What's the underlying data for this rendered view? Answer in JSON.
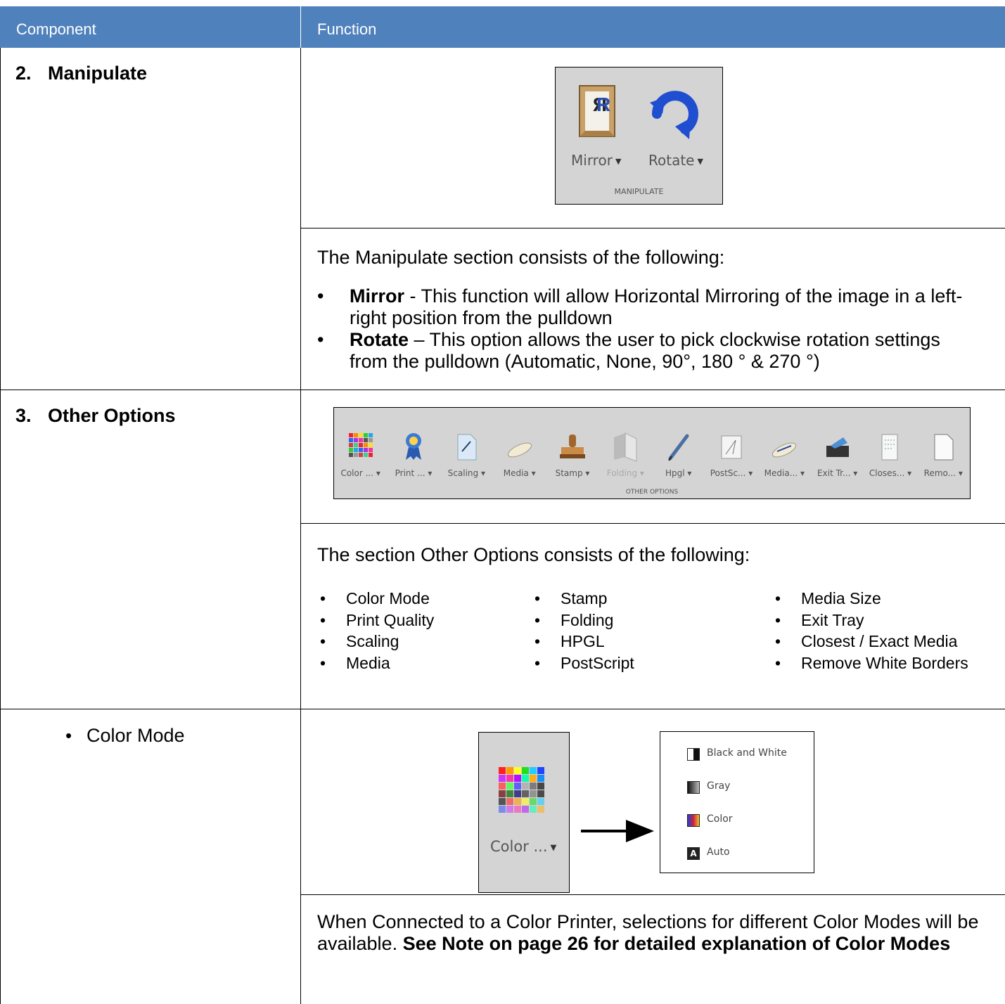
{
  "header": {
    "col1": "Component",
    "col2": "Function"
  },
  "manipulate": {
    "number": "2.",
    "label": "Manipulate",
    "toolbar": {
      "mirror": "Mirror",
      "rotate": "Rotate",
      "group": "MANIPULATE"
    },
    "intro": "The Manipulate section consists of the following:",
    "bullets": [
      {
        "bold": "Mirror",
        "text": " - This function will allow Horizontal Mirroring of the image in a left-right position from the pulldown"
      },
      {
        "bold": "Rotate",
        "text": " – This option allows the user to pick clockwise rotation settings from the pulldown (Automatic, None, 90°, 180 ° & 270 °)"
      }
    ]
  },
  "other": {
    "number": "3.",
    "label": "Other Options",
    "toolbar": {
      "items": [
        "Color ...",
        "Print ...",
        "Scaling",
        "Media",
        "Stamp",
        "Folding",
        "Hpgl",
        "PostSc...",
        "Media...",
        "Exit Tr...",
        "Closes...",
        "Remo..."
      ],
      "group": "OTHER OPTIONS"
    },
    "intro": "The section Other Options consists of the following:",
    "col1": [
      "Color Mode",
      "Print Quality",
      "Scaling",
      "Media"
    ],
    "col2": [
      "Stamp",
      "Folding",
      "HPGL",
      "PostScript"
    ],
    "col3": [
      "Media Size",
      "Exit Tray",
      "Closest / Exact Media",
      "Remove White Borders"
    ]
  },
  "color_mode": {
    "label": "Color Mode",
    "button": "Color ...",
    "menu": [
      "Black and White",
      "Gray",
      "Color",
      "Auto"
    ],
    "text_plain": "When Connected to a Color Printer, selections for different Color Modes will be available. ",
    "text_bold": "See Note on page 26 for detailed explanation of Color Modes"
  }
}
